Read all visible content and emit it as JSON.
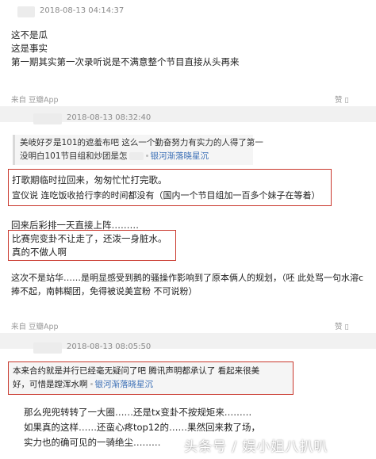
{
  "post1": {
    "timestamp": "2018-08-13 04:14:37",
    "lines": [
      "这不是瓜",
      "这是事实",
      "第一期其实第一次录听说是不满意整个节目直接从头再来"
    ],
    "source": "来自 豆瓣App",
    "like": "赞"
  },
  "post2": {
    "timestamp": "2018-08-13 08:32:40",
    "quote_line1": "美岐好歹是101的遮羞布吧 这么一个勤奋努力有实力的人得了第一",
    "quote_line2": "没明白101节目组和炒团是怎",
    "quote_link": "银河渐落晓星沉",
    "box1_line1": "打歌期临时拉回来，匆匆忙忙打完歌。",
    "box1_line2": "宣仪说 连吃饭收拾行李的时间都没有（国内一个节目组加一百多个妹子在等着）",
    "plain_line": "回来后彩排一天直接上阵………",
    "box2_line1": "比赛完变卦不让走了，还泼一身脏水。",
    "box2_line2": "真的不做人啊",
    "para_line1": "这次不是站华……是明显感受到鹅的骚操作影响到了原本俩人的规划，（呸 此处骂一句水溶c",
    "para_line2": "捧不起，南韩糊团，免得被说美宣粉 不可说粉）",
    "source": "来自 豆瓣App",
    "like": "赞"
  },
  "post3": {
    "timestamp": "2018-08-13 08:05:50",
    "quote_line1": "本来合约就是并行已经毫无疑问了吧 腾讯声明都承认了 看起来很美",
    "quote_line2": "好，可惜是蹚浑水啊",
    "quote_link": "银河渐落晓星沉",
    "lines": [
      "那么兜兜转转了一大圈……还是tx变卦不按规矩来………",
      "如果真的这样……还蛮心疼top12的……果然回来救了场，",
      "实力也的确可见的一骑绝尘………"
    ]
  },
  "watermark": "头条号 / 娱小姐八扒叭"
}
